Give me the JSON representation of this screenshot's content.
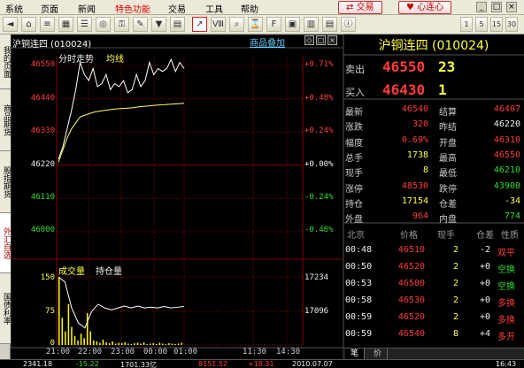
{
  "menu": {
    "items": [
      "系统",
      "页面",
      "新闻",
      "特色功能",
      "交易",
      "工具",
      "帮助"
    ],
    "active_index": 3,
    "trade_button": "交易",
    "heart_button": "心连心",
    "win_controls": [
      "_",
      "□",
      "×"
    ]
  },
  "toolbar": {
    "icons": [
      "back-icon",
      "home-icon",
      "list-icon",
      "grid-icon",
      "menu-icon",
      "target-icon",
      "lock-icon",
      "pen-icon",
      "funnel-icon",
      "book-icon",
      "trend-chart-icon",
      "kline-icon",
      "search-icon",
      "time-share-icon",
      "f10-icon",
      "calendar-icon",
      "report-icon",
      "board-icon",
      "info-icon"
    ],
    "labels": [
      "◄",
      "⌂",
      "≡",
      "▦",
      "☰",
      "◎",
      "⚿",
      "✎",
      "▼",
      "▤",
      "↗",
      "Ⅷ",
      "⌕",
      "⌛",
      "F",
      "▣",
      "▥",
      "▤",
      "ⓘ"
    ],
    "numbers": [
      "1",
      "5",
      "15",
      "30"
    ]
  },
  "left_tabs": [
    "我的页面",
    "商品期货",
    "股指期货",
    "外汇自选",
    "国债利率"
  ],
  "left_tab_selected": 3,
  "chart": {
    "instrument": "沪铜连四 (010024)",
    "overlay_link": "商品叠加",
    "legend_price": "分时走势",
    "legend_avg": "均线",
    "legend_vol": "成交量",
    "legend_oi": "持仓量",
    "price_ticks": [
      "46550",
      "46440",
      "46330",
      "46220",
      "46110",
      "46000"
    ],
    "pct_ticks": [
      "+0.71%",
      "+0.48%",
      "+0.24%",
      "+0.00%",
      "-0.24%",
      "-0.48%"
    ],
    "vol_ticks": [
      "150",
      "75",
      "0"
    ],
    "oi_ticks": [
      "17234",
      "17096"
    ],
    "time_ticks": [
      "21:00",
      "22:00",
      "23:00",
      "00:00",
      "01:00",
      "11:30",
      "14:30"
    ],
    "ctrl_icons": [
      "◇",
      "□",
      "×"
    ]
  },
  "chart_data": {
    "type": "line",
    "x_range": [
      "21:00",
      "01:00"
    ],
    "ylim": [
      46000,
      46550
    ],
    "prev_settle": 46220,
    "series": [
      {
        "name": "分时走势",
        "values": [
          46240,
          46280,
          46340,
          46400,
          46470,
          46560,
          46520,
          46500,
          46540,
          46480,
          46490,
          46520,
          46470,
          46490,
          46480,
          46500,
          46460,
          46470,
          46520,
          46480,
          46500,
          46560,
          46520,
          46540,
          46530,
          46540,
          46580,
          46530,
          46560,
          46540
        ]
      },
      {
        "name": "均线",
        "values": [
          46230,
          46270,
          46310,
          46340,
          46360,
          46380,
          46385,
          46390,
          46395,
          46398,
          46400,
          46402,
          46404,
          46406,
          46407,
          46408,
          46409,
          46410,
          46412,
          46414,
          46415,
          46416,
          46418,
          46419,
          46420,
          46421,
          46422,
          46423,
          46424,
          46425
        ]
      },
      {
        "name": "持仓量",
        "values": [
          17234,
          17220,
          17150,
          17110,
          17096,
          17140,
          17160,
          17150,
          17145,
          17150,
          17155,
          17150,
          17155,
          17150,
          17152,
          17150,
          17154,
          17150,
          17152,
          17154
        ]
      },
      {
        "name": "成交量",
        "values": [
          150,
          60,
          30,
          90,
          40,
          20,
          10,
          25,
          15,
          70,
          30,
          10,
          8,
          5,
          12,
          6,
          4,
          8,
          3,
          5,
          4,
          6,
          3,
          2,
          4,
          5,
          3,
          6,
          2,
          3,
          4,
          2,
          5,
          3,
          2,
          4,
          3,
          2,
          3,
          5
        ]
      }
    ],
    "vol_ylim": [
      0,
      150
    ],
    "oi_ylim": [
      17050,
      17234
    ]
  },
  "quote": {
    "title": "沪铜连四 (010024)",
    "sell_label": "卖出",
    "sell_price": "46550",
    "sell_vol": "23",
    "buy_label": "买入",
    "buy_price": "46430",
    "buy_vol": "1",
    "rows": [
      {
        "l1": "最新",
        "v1": "46540",
        "c1": "red",
        "l2": "结算",
        "v2": "46407",
        "c2": "red"
      },
      {
        "l1": "涨跌",
        "v1": "320",
        "c1": "red",
        "l2": "昨结",
        "v2": "46220",
        "c2": "white"
      },
      {
        "l1": "幅度",
        "v1": "0.69%",
        "c1": "red",
        "l2": "开盘",
        "v2": "46310",
        "c2": "red"
      },
      {
        "l1": "总手",
        "v1": "1738",
        "c1": "yellow",
        "l2": "最高",
        "v2": "46550",
        "c2": "red"
      },
      {
        "l1": "现手",
        "v1": "8",
        "c1": "yellow",
        "l2": "最低",
        "v2": "46210",
        "c2": "green"
      },
      {
        "l1": "涨停",
        "v1": "48530",
        "c1": "red",
        "l2": "跌停",
        "v2": "43900",
        "c2": "green"
      },
      {
        "l1": "持仓",
        "v1": "17154",
        "c1": "yellow",
        "l2": "仓差",
        "v2": "-34",
        "c2": "yellow"
      },
      {
        "l1": "外盘",
        "v1": "964",
        "c1": "red",
        "l2": "内盘",
        "v2": "774",
        "c2": "green"
      }
    ]
  },
  "ticks": {
    "headers": [
      "北京",
      "价格",
      "现手",
      "仓差",
      "性质"
    ],
    "rows": [
      {
        "time": "00:48",
        "price": "46510",
        "vol": "2",
        "diff": "-2",
        "nature": "双平",
        "color": "red"
      },
      {
        "time": "00:50",
        "price": "46520",
        "vol": "2",
        "diff": "+0",
        "nature": "空换",
        "color": "green"
      },
      {
        "time": "00:53",
        "price": "46500",
        "vol": "2",
        "diff": "+0",
        "nature": "空换",
        "color": "green"
      },
      {
        "time": "00:58",
        "price": "46530",
        "vol": "2",
        "diff": "+0",
        "nature": "多换",
        "color": "red"
      },
      {
        "time": "00:59",
        "price": "46520",
        "vol": "2",
        "diff": "+0",
        "nature": "多换",
        "color": "red"
      },
      {
        "time": "00:59",
        "price": "46540",
        "vol": "8",
        "diff": "+4",
        "nature": "多开",
        "color": "red"
      }
    ]
  },
  "bottom_tabs": [
    "笔",
    "价"
  ],
  "status": [
    "2341.18",
    "-15.22",
    "1701.33亿",
    "8151.52",
    "+18.31",
    "2010.07.07",
    "16:43"
  ],
  "colors": {
    "up": "#ff3c3c",
    "down": "#2cdc2c",
    "grid": "#8b0000",
    "price_line": "#ffffff",
    "avg_line": "#ffff66",
    "vol_bar": "#ffff00"
  }
}
